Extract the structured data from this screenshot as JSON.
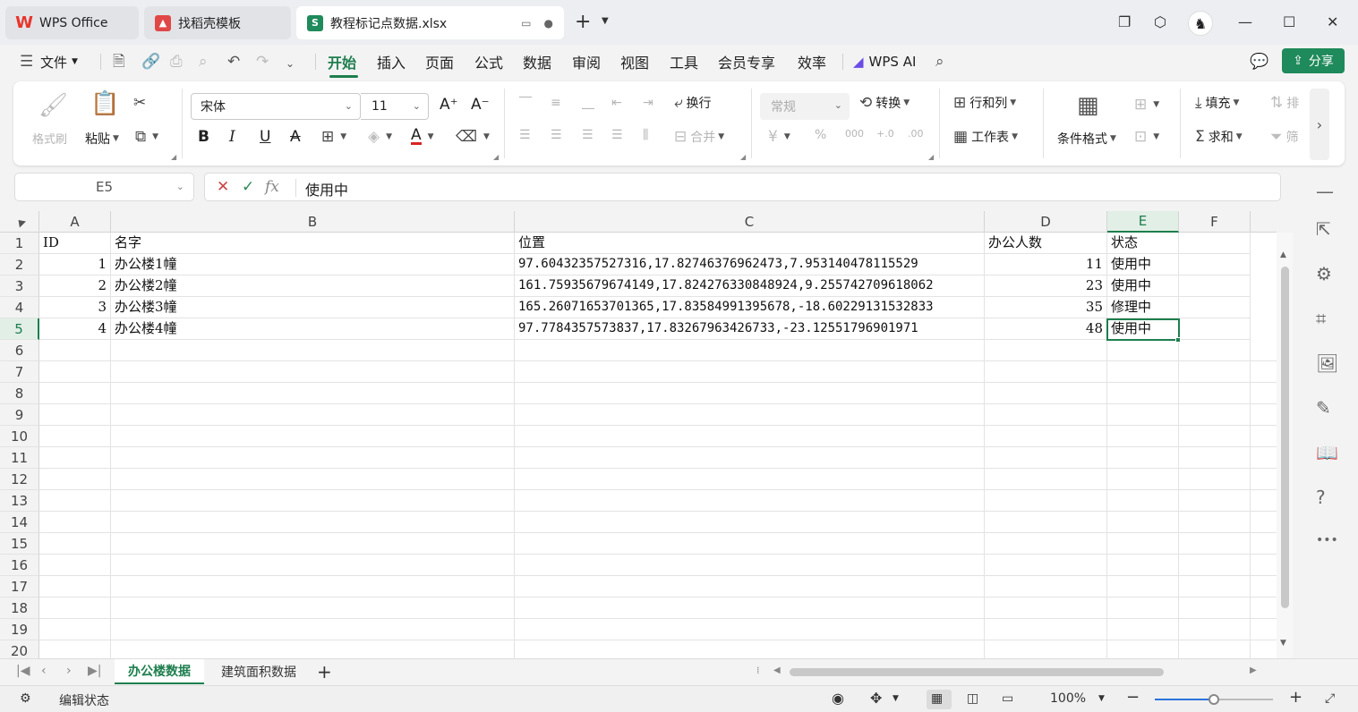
{
  "titlebar": {
    "tabs": [
      {
        "label": "WPS Office",
        "icon": "wps-logo-icon",
        "color": "#e8352b"
      },
      {
        "label": "找稻壳模板",
        "icon": "docer-icon",
        "color": "#e04848"
      },
      {
        "label": "教程标记点数据.xlsx",
        "icon": "spreadsheet-icon",
        "color": "#1f8a5b"
      }
    ]
  },
  "menubar": {
    "file": "文件",
    "tabs": [
      "开始",
      "插入",
      "页面",
      "公式",
      "数据",
      "审阅",
      "视图",
      "工具",
      "会员专享",
      "效率"
    ],
    "active_tab": "开始",
    "wps_ai": "WPS AI",
    "share": "分享",
    "accent": "#1e7e4e"
  },
  "ribbon": {
    "format_painter": "格式刷",
    "paste": "粘贴",
    "font_name": "宋体",
    "font_size": "11",
    "wrap": "换行",
    "merge": "合并",
    "number_format": "常规",
    "convert": "转换",
    "rows_cols": "行和列",
    "worksheet": "工作表",
    "conditional_format": "条件格式",
    "fill": "填充",
    "sort": "排",
    "sum": "求和",
    "filter": "筛"
  },
  "formula": {
    "cell_ref": "E5",
    "fx": "fx",
    "value": "使用中"
  },
  "grid": {
    "columns": [
      "A",
      "B",
      "C",
      "D",
      "E",
      "F"
    ],
    "selected_column": "E",
    "rows": [
      "1",
      "2",
      "3",
      "4",
      "5",
      "6",
      "7",
      "8",
      "9",
      "10",
      "11",
      "12",
      "13",
      "14",
      "15",
      "16",
      "17",
      "18",
      "19",
      "20"
    ],
    "selected_row": "5",
    "header": [
      "ID",
      "名字",
      "位置",
      "办公人数",
      "状态"
    ],
    "data": [
      [
        "1",
        "办公楼1幢",
        "97.60432357527316,17.82746376962473,7.953140478115529",
        "11",
        "使用中"
      ],
      [
        "2",
        "办公楼2幢",
        "161.75935679674149,17.824276330848924,9.255742709618062",
        "23",
        "使用中"
      ],
      [
        "3",
        "办公楼3幢",
        "165.26071653701365,17.83584991395678,-18.60229131532833",
        "35",
        "修理中"
      ],
      [
        "4",
        "办公楼4幢",
        "97.7784357573837,17.83267963426733,-23.12551796901971",
        "48",
        "使用中"
      ]
    ]
  },
  "sheets": {
    "tabs": [
      "办公楼数据",
      "建筑面积数据"
    ],
    "active": "办公楼数据"
  },
  "status": {
    "mode": "编辑状态",
    "zoom": "100%",
    "zoom_fraction": 0.5
  }
}
